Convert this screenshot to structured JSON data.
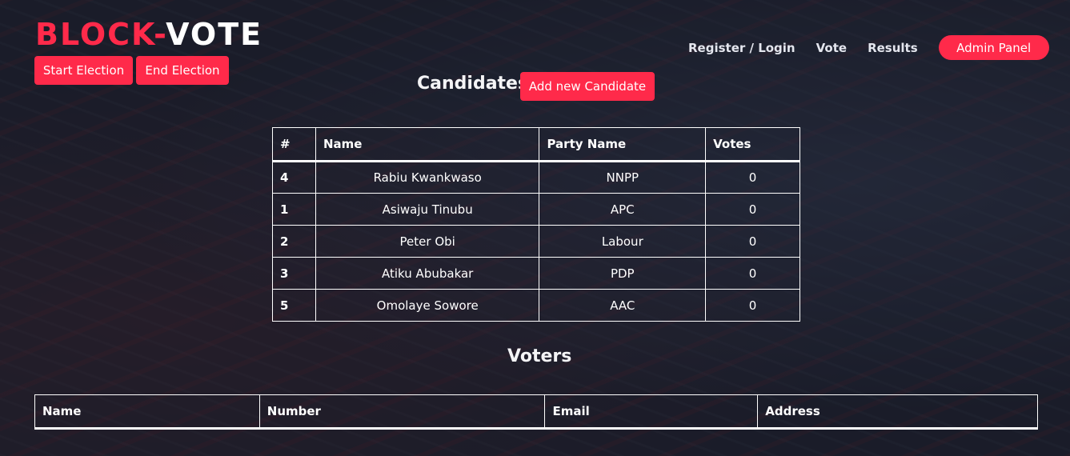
{
  "brand": {
    "part1": "BLOCK-",
    "part2": "VOTE"
  },
  "actions": {
    "start_election": "Start Election",
    "end_election": "End Election"
  },
  "nav": {
    "register_login": "Register / Login",
    "vote": "Vote",
    "results": "Results",
    "admin_panel": "Admin Panel"
  },
  "candidates": {
    "title": "Candidates",
    "add_button": "Add new Candidate",
    "columns": [
      "#",
      "Name",
      "Party Name",
      "Votes"
    ],
    "rows": [
      {
        "id": "4",
        "name": "Rabiu Kwankwaso",
        "party": "NNPP",
        "votes": "0"
      },
      {
        "id": "1",
        "name": "Asiwaju Tinubu",
        "party": "APC",
        "votes": "0"
      },
      {
        "id": "2",
        "name": "Peter Obi",
        "party": "Labour",
        "votes": "0"
      },
      {
        "id": "3",
        "name": "Atiku Abubakar",
        "party": "PDP",
        "votes": "0"
      },
      {
        "id": "5",
        "name": "Omolaye Sowore",
        "party": "AAC",
        "votes": "0"
      }
    ]
  },
  "voters": {
    "title": "Voters",
    "columns": [
      "Name",
      "Number",
      "Email",
      "Address"
    ]
  },
  "colors": {
    "accent": "#ff2a4a",
    "text": "#ffffff"
  }
}
